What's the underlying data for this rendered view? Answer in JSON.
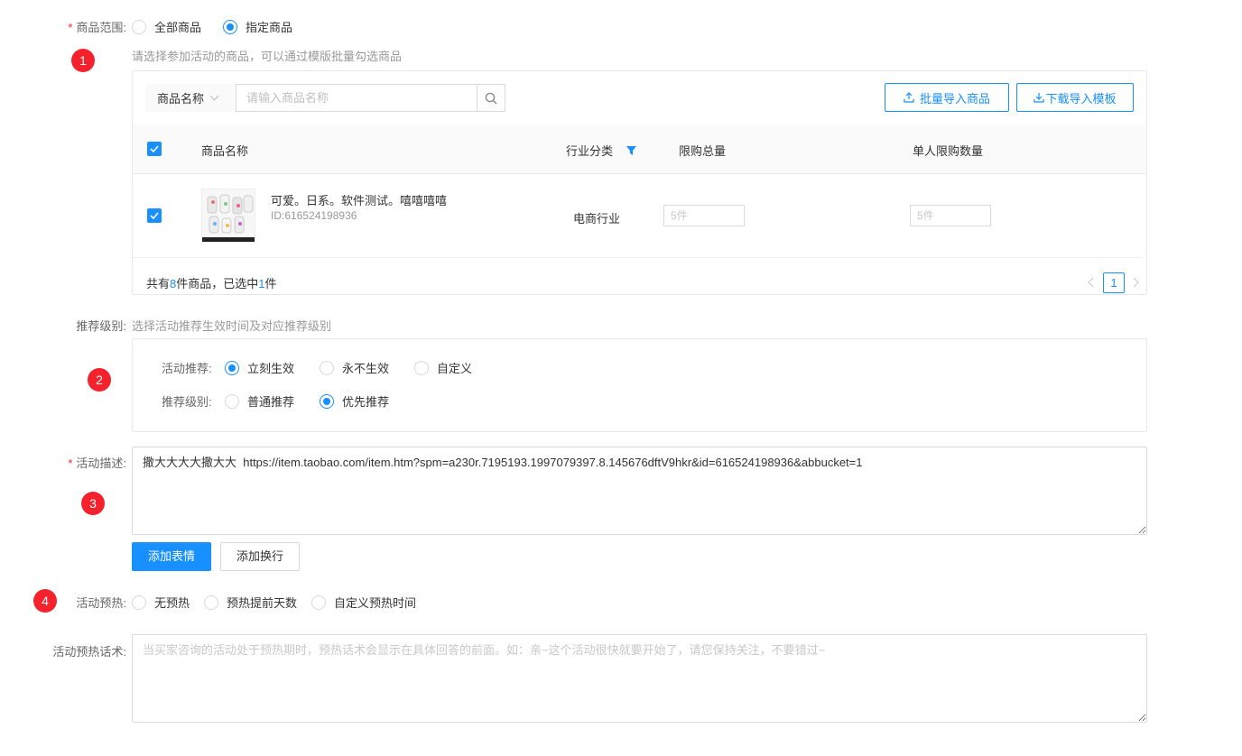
{
  "scope": {
    "label": "商品范围:",
    "options": [
      "全部商品",
      "指定商品"
    ],
    "selected": 1,
    "hint": "请选择参加活动的商品，可以通过模版批量勾选商品",
    "marker": "1"
  },
  "search": {
    "field": "商品名称",
    "placeholder": "请输入商品名称"
  },
  "buttons": {
    "bulk_import": "批量导入商品",
    "download_template": "下载导入模板",
    "add_emoji": "添加表情",
    "add_newline": "添加换行"
  },
  "table": {
    "columns": [
      "商品名称",
      "行业分类",
      "限购总量",
      "单人限购数量"
    ],
    "rows": [
      {
        "checked": true,
        "name": "可爱。日系。软件测试。嘻嘻嘻嘻",
        "id": "ID:616524198936",
        "industry": "电商行业",
        "limit_total_placeholder": "5件",
        "limit_per_user_placeholder": "5件"
      }
    ],
    "footer": {
      "prefix": "共有",
      "total": "8",
      "middle": "件商品，已选中",
      "selected": "1",
      "suffix": "件"
    },
    "page": "1"
  },
  "recommend": {
    "label": "推荐级别:",
    "hint": "选择活动推荐生效时间及对应推荐级别",
    "marker": "2",
    "activity": {
      "label": "活动推荐:",
      "options": [
        "立刻生效",
        "永不生效",
        "自定义"
      ],
      "selected": 0
    },
    "level": {
      "label": "推荐级别:",
      "options": [
        "普通推荐",
        "优先推荐"
      ],
      "selected": 1
    }
  },
  "description": {
    "label": "活动描述:",
    "marker": "3",
    "value": "撒大大大大撒大大  https://item.taobao.com/item.htm?spm=a230r.7195193.1997079397.8.145676dftV9hkr&id=616524198936&abbucket=1"
  },
  "preheat": {
    "label": "活动预热:",
    "marker": "4",
    "options": [
      "无预热",
      "预热提前天数",
      "自定义预热时间"
    ]
  },
  "preheat_text": {
    "label": "活动预热话术:",
    "placeholder": "当买家咨询的活动处于预热期时，预热话术会显示在具体回答的前面。如：亲~这个活动很快就要开始了，请您保持关注，不要错过~"
  },
  "colors": {
    "primary": "#1890ff",
    "required": "#f5222d",
    "marker": "#f5222d"
  }
}
